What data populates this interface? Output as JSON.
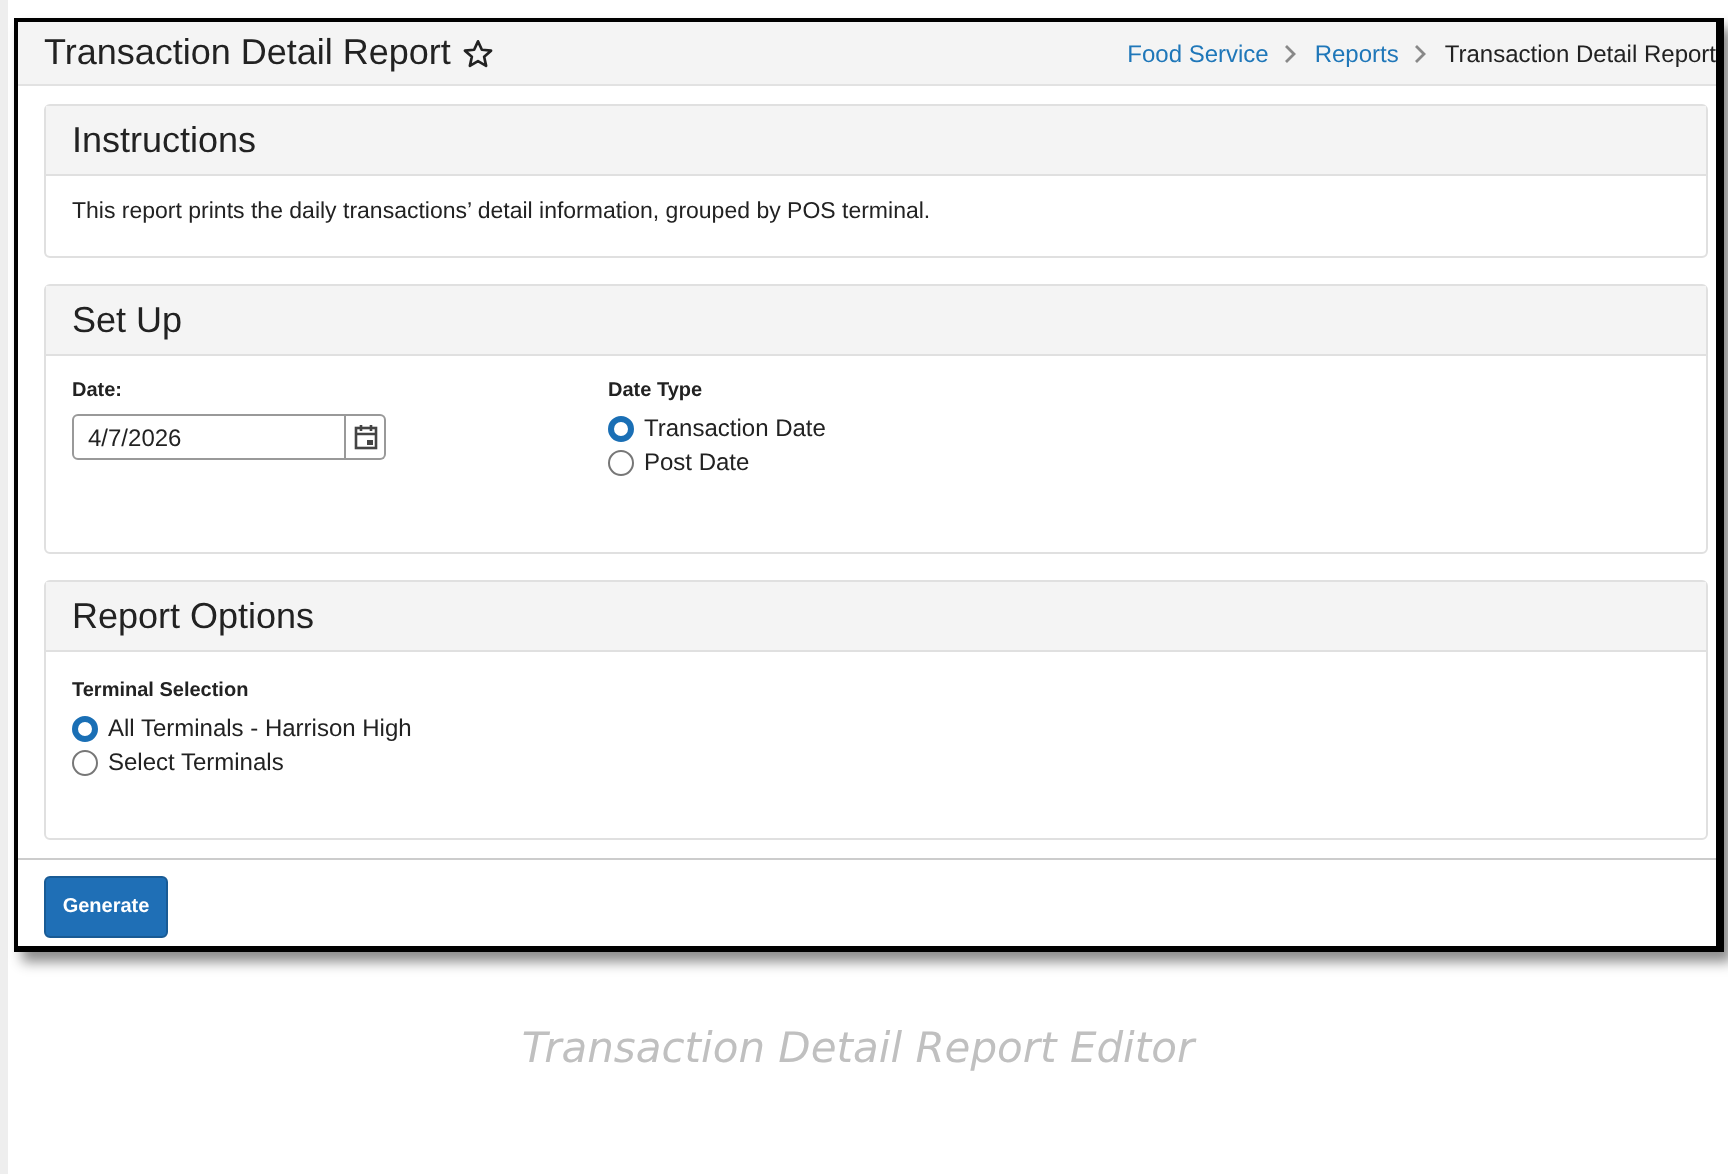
{
  "header": {
    "title": "Transaction Detail Report",
    "favorite": false,
    "breadcrumbs": [
      {
        "label": "Food Service",
        "kind": "link"
      },
      {
        "label": "Reports",
        "kind": "link"
      },
      {
        "label": "Transaction Detail Report",
        "kind": "current"
      }
    ]
  },
  "instructions": {
    "title": "Instructions",
    "text": "This report prints the daily transactions’ detail information, grouped by POS terminal."
  },
  "setup": {
    "title": "Set Up",
    "date": {
      "label": "Date:",
      "value": "4/7/2026"
    },
    "date_type": {
      "label": "Date Type",
      "options": [
        {
          "label": "Transaction Date",
          "selected": true
        },
        {
          "label": "Post Date",
          "selected": false
        }
      ]
    }
  },
  "report_options": {
    "title": "Report Options",
    "terminal_selection": {
      "label": "Terminal Selection",
      "options": [
        {
          "label": "All Terminals - Harrison High",
          "selected": true
        },
        {
          "label": "Select Terminals",
          "selected": false
        }
      ]
    }
  },
  "buttons": [
    {
      "label": "Generate"
    }
  ],
  "caption": "Transaction Detail Report Editor"
}
